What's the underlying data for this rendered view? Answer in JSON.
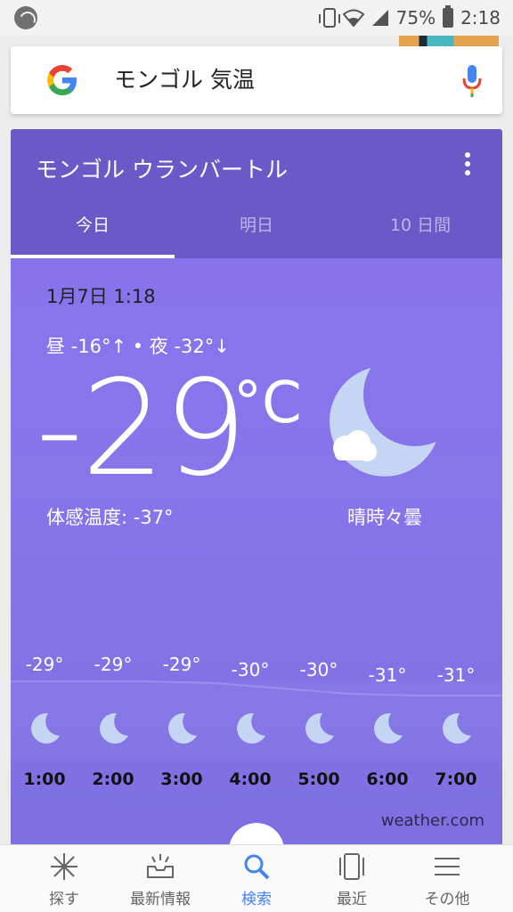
{
  "status_bar": {
    "battery_percent": "75%",
    "time": "2:18",
    "icons": [
      "app-icon",
      "vibrate-icon",
      "wifi-icon",
      "signal-icon",
      "battery-icon"
    ]
  },
  "search": {
    "query": "モンゴル 気温",
    "icons": [
      "google-logo",
      "mic-icon"
    ]
  },
  "weather": {
    "location": "モンゴル ウランバートル",
    "tabs": [
      {
        "label": "今日",
        "active": true
      },
      {
        "label": "明日",
        "active": false
      },
      {
        "label": "10 日間",
        "active": false
      }
    ],
    "datetime": "1月7日 1:18",
    "hilo": "昼 -16°↑ • 夜 -32°↓",
    "temperature": "-29",
    "unit": "°C",
    "feels_like": "体感温度: -37°",
    "condition": "晴時々曇",
    "condition_icon": "moon-cloud-icon",
    "hourly": [
      {
        "temp": "-29°",
        "time": "1:00",
        "icon": "moon-icon"
      },
      {
        "temp": "-29°",
        "time": "2:00",
        "icon": "moon-icon"
      },
      {
        "temp": "-29°",
        "time": "3:00",
        "icon": "moon-icon"
      },
      {
        "temp": "-30°",
        "time": "4:00",
        "icon": "moon-icon"
      },
      {
        "temp": "-30°",
        "time": "5:00",
        "icon": "moon-icon"
      },
      {
        "temp": "-31°",
        "time": "6:00",
        "icon": "moon-icon"
      },
      {
        "temp": "-31°",
        "time": "7:00",
        "icon": "moon-icon"
      }
    ],
    "source": "weather.com"
  },
  "bottom_nav": {
    "items": [
      {
        "label": "探す",
        "icon": "sparkle-icon",
        "active": false
      },
      {
        "label": "最新情報",
        "icon": "updates-tray-icon",
        "active": false
      },
      {
        "label": "検索",
        "icon": "search-icon",
        "active": true
      },
      {
        "label": "最近",
        "icon": "recent-cards-icon",
        "active": false
      },
      {
        "label": "その他",
        "icon": "menu-icon",
        "active": false
      }
    ]
  },
  "colors": {
    "card_header": "#6a59c6",
    "card_body": "#8a72ee",
    "accent_blue": "#4285f4"
  }
}
